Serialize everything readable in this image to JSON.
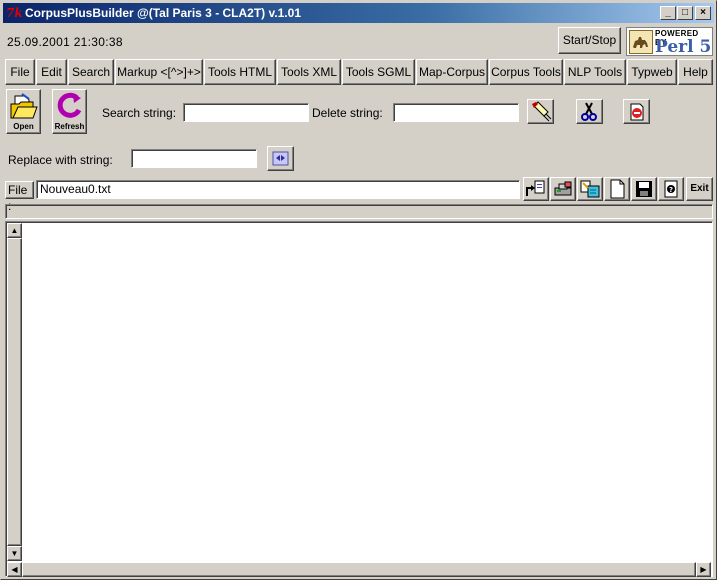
{
  "window": {
    "title": "CorpusPlusBuilder @(Tal Paris 3 - CLA2T) v.1.01",
    "app_icon_text": "7k",
    "minimize": "_",
    "maximize": "□",
    "close": "×"
  },
  "header": {
    "datetime": "25.09.2001  21:30:38",
    "start_stop_label": "Start/Stop",
    "perl_powered": "POWERED BY",
    "perl_text": "Perl 5"
  },
  "menu": {
    "items": [
      {
        "label": "File"
      },
      {
        "label": "Edit"
      },
      {
        "label": "Search"
      },
      {
        "label": "Markup <[^>]+>"
      },
      {
        "label": "Tools HTML"
      },
      {
        "label": "Tools XML"
      },
      {
        "label": "Tools SGML"
      },
      {
        "label": "Map-Corpus"
      },
      {
        "label": "Corpus Tools"
      },
      {
        "label": "NLP Tools"
      },
      {
        "label": "Typweb"
      },
      {
        "label": "Help"
      }
    ]
  },
  "toolbar": {
    "open_label": "Open",
    "refresh_label": "Refresh",
    "search_label": "Search string:",
    "search_value": "",
    "delete_label": "Delete string:",
    "delete_value": "",
    "replace_label": "Replace with string:",
    "replace_value": ""
  },
  "filebar": {
    "label": "File :",
    "filename": "Nouveau0.txt",
    "exit_label": "Exit"
  },
  "colors": {
    "title_start": "#0a246a",
    "title_end": "#a6caf0",
    "face": "#d4d0c8"
  }
}
